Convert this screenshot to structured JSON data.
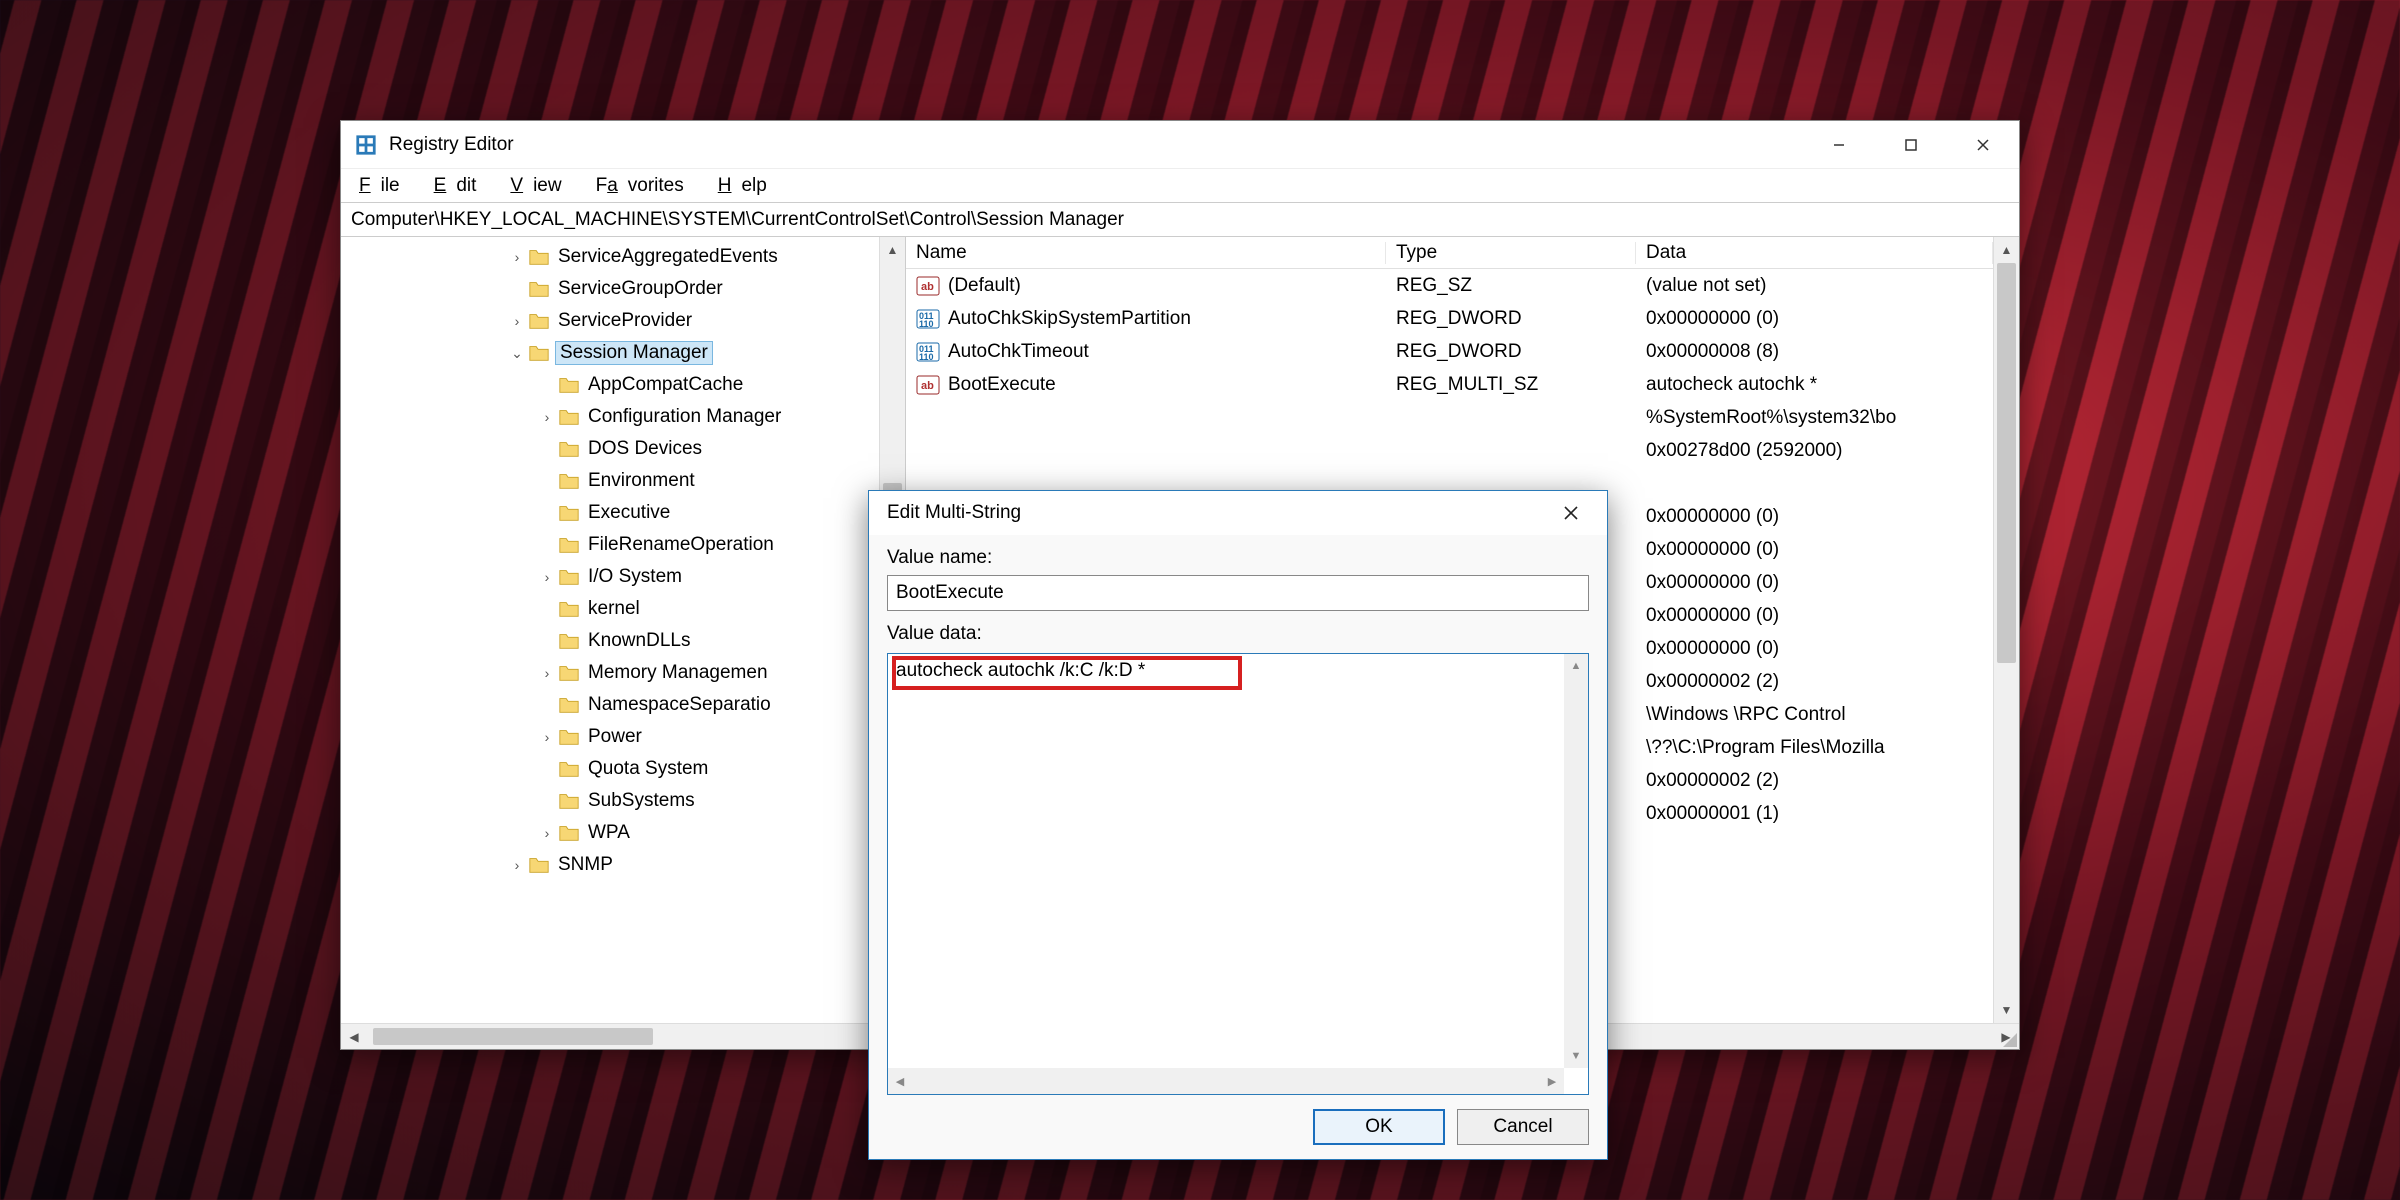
{
  "app_title": "Registry Editor",
  "menu": {
    "file": "File",
    "edit": "Edit",
    "view": "View",
    "favorites": "Favorites",
    "help": "Help"
  },
  "address": "Computer\\HKEY_LOCAL_MACHINE\\SYSTEM\\CurrentControlSet\\Control\\Session Manager",
  "tree": {
    "items": [
      {
        "depth": 0,
        "chev": ">",
        "label": "ServiceAggregatedEvents"
      },
      {
        "depth": 0,
        "chev": "",
        "label": "ServiceGroupOrder"
      },
      {
        "depth": 0,
        "chev": ">",
        "label": "ServiceProvider"
      },
      {
        "depth": 0,
        "chev": "v",
        "label": "Session Manager",
        "selected": true
      },
      {
        "depth": 1,
        "chev": "",
        "label": "AppCompatCache"
      },
      {
        "depth": 1,
        "chev": ">",
        "label": "Configuration Manager"
      },
      {
        "depth": 1,
        "chev": "",
        "label": "DOS Devices"
      },
      {
        "depth": 1,
        "chev": "",
        "label": "Environment"
      },
      {
        "depth": 1,
        "chev": "",
        "label": "Executive"
      },
      {
        "depth": 1,
        "chev": "",
        "label": "FileRenameOperation"
      },
      {
        "depth": 1,
        "chev": ">",
        "label": "I/O System"
      },
      {
        "depth": 1,
        "chev": "",
        "label": "kernel"
      },
      {
        "depth": 1,
        "chev": "",
        "label": "KnownDLLs"
      },
      {
        "depth": 1,
        "chev": ">",
        "label": "Memory Managemen"
      },
      {
        "depth": 1,
        "chev": "",
        "label": "NamespaceSeparatio"
      },
      {
        "depth": 1,
        "chev": ">",
        "label": "Power"
      },
      {
        "depth": 1,
        "chev": "",
        "label": "Quota System"
      },
      {
        "depth": 1,
        "chev": "",
        "label": "SubSystems"
      },
      {
        "depth": 1,
        "chev": ">",
        "label": "WPA"
      },
      {
        "depth": 0,
        "chev": ">",
        "label": "SNMP"
      }
    ]
  },
  "columns": {
    "name": "Name",
    "type": "Type",
    "data": "Data"
  },
  "values": [
    {
      "icon": "sz",
      "name": "(Default)",
      "type": "REG_SZ",
      "data": "(value not set)"
    },
    {
      "icon": "bin",
      "name": "AutoChkSkipSystemPartition",
      "type": "REG_DWORD",
      "data": "0x00000000 (0)"
    },
    {
      "icon": "bin",
      "name": "AutoChkTimeout",
      "type": "REG_DWORD",
      "data": "0x00000008 (8)"
    },
    {
      "icon": "sz",
      "name": "BootExecute",
      "type": "REG_MULTI_SZ",
      "data": "autocheck autochk *"
    },
    {
      "icon": "",
      "name": "",
      "type": "",
      "data": "%SystemRoot%\\system32\\bo"
    },
    {
      "icon": "",
      "name": "",
      "type": "",
      "data": "0x00278d00 (2592000)"
    },
    {
      "icon": "",
      "name": "",
      "type": "",
      "data": ""
    },
    {
      "icon": "",
      "name": "",
      "type": "",
      "data": "0x00000000 (0)"
    },
    {
      "icon": "",
      "name": "",
      "type": "",
      "data": "0x00000000 (0)"
    },
    {
      "icon": "",
      "name": "",
      "type": "",
      "data": "0x00000000 (0)"
    },
    {
      "icon": "",
      "name": "",
      "type": "",
      "data": "0x00000000 (0)"
    },
    {
      "icon": "",
      "name": "",
      "type": "",
      "data": "0x00000000 (0)"
    },
    {
      "icon": "",
      "name": "",
      "type": "",
      "data": "0x00000002 (2)"
    },
    {
      "icon": "",
      "name": "",
      "type": "",
      "data": "\\Windows \\RPC Control"
    },
    {
      "icon": "",
      "name": "",
      "type": "",
      "data": "\\??\\C:\\Program Files\\Mozilla"
    },
    {
      "icon": "",
      "name": "",
      "type": "",
      "data": "0x00000002 (2)"
    },
    {
      "icon": "",
      "name": "",
      "type": "",
      "data": "0x00000001 (1)"
    }
  ],
  "dialog": {
    "title": "Edit Multi-String",
    "value_name_label": "Value name:",
    "value_name": "BootExecute",
    "value_data_label": "Value data:",
    "value_data": "autocheck autochk /k:C /k:D *",
    "ok": "OK",
    "cancel": "Cancel"
  }
}
